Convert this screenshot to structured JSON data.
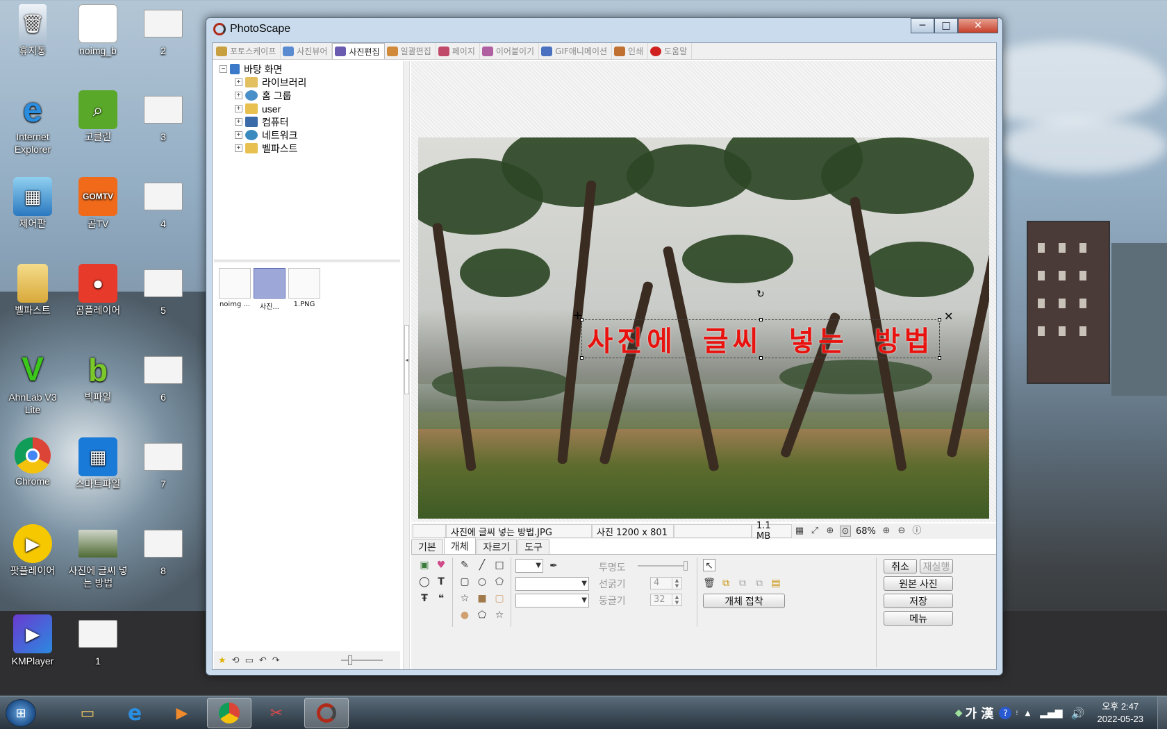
{
  "desktop": {
    "icons": [
      {
        "label": "휴지통",
        "icon": "recycle-bin-icon"
      },
      {
        "label": "noimg_b",
        "icon": "image-file-icon"
      },
      {
        "label": "2",
        "icon": "screenshot-file-icon"
      },
      {
        "label": "Internet Explorer",
        "icon": "internet-explorer-icon"
      },
      {
        "label": "고클린",
        "icon": "goclean-icon"
      },
      {
        "label": "3",
        "icon": "screenshot-file-icon"
      },
      {
        "label": "제어판",
        "icon": "control-panel-icon"
      },
      {
        "label": "곰TV",
        "icon": "gomtv-icon"
      },
      {
        "label": "4",
        "icon": "screenshot-file-icon"
      },
      {
        "label": "벨파스트",
        "icon": "folder-icon"
      },
      {
        "label": "곰플레이어",
        "icon": "gomplayer-icon"
      },
      {
        "label": "5",
        "icon": "screenshot-file-icon"
      },
      {
        "label": "AhnLab V3 Lite",
        "icon": "ahnlab-icon"
      },
      {
        "label": "빅파일",
        "icon": "bigfile-icon"
      },
      {
        "label": "6",
        "icon": "screenshot-file-icon"
      },
      {
        "label": "Chrome",
        "icon": "chrome-icon"
      },
      {
        "label": "스마트파일",
        "icon": "smartfile-icon"
      },
      {
        "label": "7",
        "icon": "screenshot-file-icon"
      },
      {
        "label": "팟플레이어",
        "icon": "potplayer-icon"
      },
      {
        "label": "사진에 글씨 넣는 방법",
        "icon": "photo-file-icon"
      },
      {
        "label": "8",
        "icon": "screenshot-file-icon"
      },
      {
        "label": "KMPlayer",
        "icon": "kmplayer-icon"
      },
      {
        "label": "1",
        "icon": "screenshot-file-icon"
      }
    ]
  },
  "window": {
    "title": "PhotoScape",
    "controls": {
      "minimize": "─",
      "maximize": "□",
      "close": "✕"
    }
  },
  "tabs": [
    {
      "label": "포토스케이프",
      "color": "#c8a040"
    },
    {
      "label": "사진뷰어",
      "color": "#5a8ad0"
    },
    {
      "label": "사진편집",
      "color": "#6a5ab0"
    },
    {
      "label": "일괄편집",
      "color": "#d08a3a"
    },
    {
      "label": "페이지",
      "color": "#c04a6a"
    },
    {
      "label": "이어붙이기",
      "color": "#b060a0"
    },
    {
      "label": "GIF애니메이션",
      "color": "#4a70c0"
    },
    {
      "label": "인쇄",
      "color": "#c07030"
    },
    {
      "label": "도움말",
      "color": "#d02020"
    }
  ],
  "tree": {
    "root": "바탕 화면",
    "items": [
      {
        "label": "라이브러리",
        "color": "#e2c060"
      },
      {
        "label": "홈 그룹",
        "color": "#4a90c8"
      },
      {
        "label": "user",
        "color": "#e8c050"
      },
      {
        "label": "컴퓨터",
        "color": "#3a6aa8"
      },
      {
        "label": "네트워크",
        "color": "#3a8ac0"
      },
      {
        "label": "벨파스트",
        "color": "#e8c050"
      }
    ]
  },
  "thumbnails": [
    {
      "label": "noimg ...",
      "selected": false
    },
    {
      "label": "사진...",
      "selected": true
    },
    {
      "label": "1.PNG",
      "selected": false
    }
  ],
  "editor": {
    "overlay_text": "사진에 글씨 넣는 방법",
    "overlay_color": "#e8120e"
  },
  "status": {
    "filename": "사진에 글씨 넣는 방법.JPG",
    "dimensions": "사진 1200 x 801",
    "filesize": "1.1 MB",
    "zoom": "68%"
  },
  "bottom_tabs": [
    "기본",
    "개체",
    "자르기",
    "도구"
  ],
  "object_panel": {
    "opacity_label": "투명도",
    "line_width_label": "선굵기",
    "line_width_value": "4",
    "roundness_label": "둥글기",
    "roundness_value": "32",
    "attach_button": "개체 접착"
  },
  "action_buttons": {
    "undo": "취소",
    "redo": "재실행",
    "original": "원본 사진",
    "save": "저장",
    "menu": "메뉴"
  },
  "taskbar": {
    "ime": "가 漢",
    "time": "오후 2:47",
    "date": "2022-05-23"
  }
}
